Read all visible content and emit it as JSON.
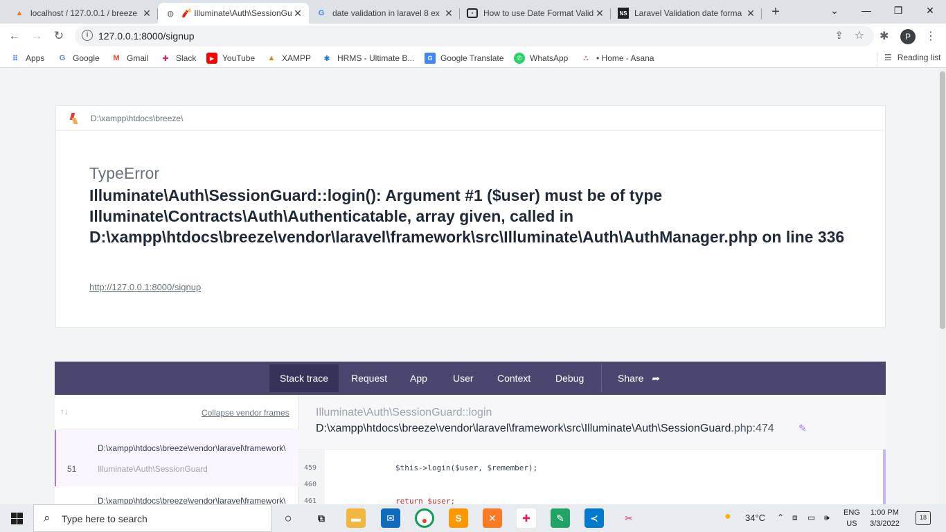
{
  "browser": {
    "tabs": [
      {
        "title": "localhost / 127.0.0.1 / breeze",
        "icon": "phpmyadmin-icon"
      },
      {
        "title": "🧨 Illuminate\\Auth\\SessionGuard",
        "icon": "globe-icon"
      },
      {
        "title": "date validation in laravel 8 ex",
        "icon": "google-icon"
      },
      {
        "title": "How to use Date Format Valid",
        "icon": "site-icon"
      },
      {
        "title": "Laravel Validation date forma",
        "icon": "ns-icon"
      }
    ],
    "ns_badge": "NS",
    "new_tab": "+",
    "url": "127.0.0.1:8000/signup",
    "profile_initial": "P",
    "bookmarks": [
      {
        "label": "Apps"
      },
      {
        "label": "Google"
      },
      {
        "label": "Gmail"
      },
      {
        "label": "Slack"
      },
      {
        "label": "YouTube"
      },
      {
        "label": "XAMPP"
      },
      {
        "label": "HRMS - Ultimate B..."
      },
      {
        "label": "Google Translate"
      },
      {
        "label": "WhatsApp"
      },
      {
        "label": "• Home - Asana"
      }
    ],
    "reading_list": "Reading list"
  },
  "error": {
    "app_path": "D:\\xampp\\htdocs\\breeze\\",
    "type": "TypeError",
    "message": "Illuminate\\Auth\\SessionGuard::login(): Argument #1 ($user) must be of type Illuminate\\Contracts\\Auth\\Authenticatable, array given, called in D:\\xampp\\htdocs\\breeze\\vendor\\laravel\\framework\\src\\Illuminate\\Auth\\AuthManager.php on line 336",
    "url": "http://127.0.0.1:8000/signup"
  },
  "nav": {
    "items": [
      "Stack trace",
      "Request",
      "App",
      "User",
      "Context",
      "Debug"
    ],
    "share": "Share"
  },
  "stack": {
    "collapse_label": "Collapse vendor frames",
    "frames": [
      {
        "path": "D:\\xampp\\htdocs\\breeze\\vendor\\laravel\\framework\\",
        "line": "51",
        "class": "Illuminate\\Auth\\SessionGuard"
      },
      {
        "path": "D:\\xampp\\htdocs\\breeze\\vendor\\laravel\\framework\\"
      }
    ],
    "selected": {
      "class": "Illuminate\\Auth\\SessionGuard::login",
      "file": "D:\\xampp\\htdocs\\breeze\\vendor\\laravel\\framework\\src\\Illuminate\\Auth\\SessionGuard",
      "ext_line": ".php:474"
    },
    "code": [
      {
        "line": "459",
        "text": "$this->login($user, $remember);"
      },
      {
        "line": "460",
        "text": ""
      },
      {
        "line": "461",
        "text": "return $user;"
      }
    ]
  },
  "taskbar": {
    "search_placeholder": "Type here to search",
    "weather": "34°C",
    "lang_top": "ENG",
    "lang_bottom": "US",
    "time": "1:00 PM",
    "date": "3/3/2022",
    "notifications": "18"
  }
}
